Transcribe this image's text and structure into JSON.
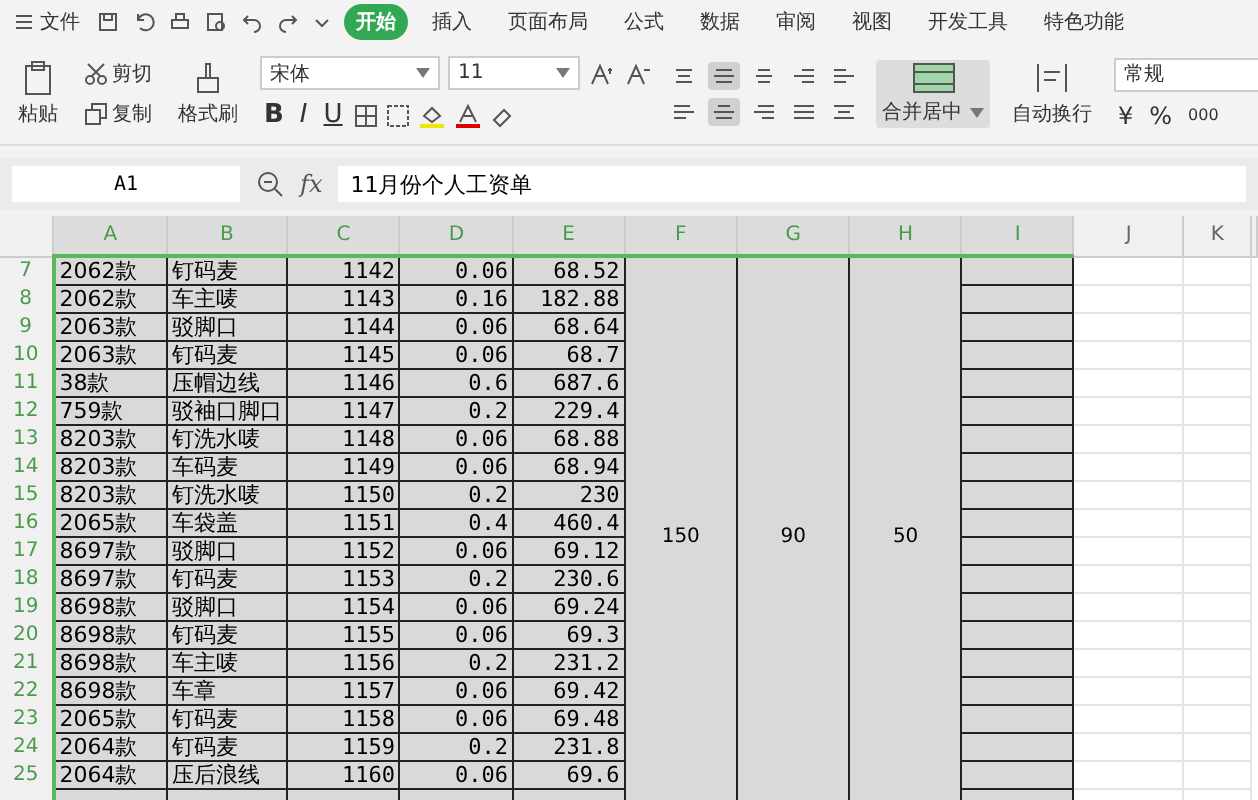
{
  "menu_bar": {
    "file_label": "文件",
    "tabs": [
      {
        "label": "开始",
        "selected": true
      },
      {
        "label": "插入",
        "selected": false
      },
      {
        "label": "页面布局",
        "selected": false
      },
      {
        "label": "公式",
        "selected": false
      },
      {
        "label": "数据",
        "selected": false
      },
      {
        "label": "审阅",
        "selected": false
      },
      {
        "label": "视图",
        "selected": false
      },
      {
        "label": "开发工具",
        "selected": false
      },
      {
        "label": "特色功能",
        "selected": false
      }
    ]
  },
  "ribbon": {
    "paste": "粘贴",
    "cut": "剪切",
    "copy": "复制",
    "format_painter": "格式刷",
    "font_name": "宋体",
    "font_size": "11",
    "bold": "B",
    "italic": "I",
    "underline": "U",
    "align_top": [
      {
        "kind": "top",
        "selected": false
      },
      {
        "kind": "middle",
        "selected": true
      },
      {
        "kind": "bottom",
        "selected": false
      },
      {
        "kind": "indent-out",
        "selected": false
      },
      {
        "kind": "indent-in",
        "selected": false
      }
    ],
    "align_bottom": [
      {
        "kind": "left",
        "selected": false
      },
      {
        "kind": "center",
        "selected": true
      },
      {
        "kind": "right",
        "selected": false
      },
      {
        "kind": "justify",
        "selected": false
      },
      {
        "kind": "distributed",
        "selected": false
      }
    ],
    "merge": "合并居中",
    "wrap": "自动换行",
    "number_format": "常规",
    "currency": "¥",
    "percent": "%",
    "thousands": "000"
  },
  "formula_bar": {
    "cell_ref": "A1",
    "fx": "fx",
    "content": "11月份个人工资单"
  },
  "sheet": {
    "columns": [
      {
        "label": "A",
        "selected": true
      },
      {
        "label": "B",
        "selected": true
      },
      {
        "label": "C",
        "selected": true
      },
      {
        "label": "D",
        "selected": true
      },
      {
        "label": "E",
        "selected": true
      },
      {
        "label": "F",
        "selected": true
      },
      {
        "label": "G",
        "selected": true
      },
      {
        "label": "H",
        "selected": true
      },
      {
        "label": "I",
        "selected": true
      },
      {
        "label": "J",
        "selected": false
      },
      {
        "label": "K",
        "selected": false
      }
    ],
    "merged": [
      "150",
      "90",
      "50"
    ],
    "rows": [
      {
        "number": "7",
        "cells": [
          "2062款",
          "钉码麦",
          "1142",
          "0.06",
          "68.52"
        ]
      },
      {
        "number": "8",
        "cells": [
          "2062款",
          "车主唛",
          "1143",
          "0.16",
          "182.88"
        ]
      },
      {
        "number": "9",
        "cells": [
          "2063款",
          "驳脚口",
          "1144",
          "0.06",
          "68.64"
        ]
      },
      {
        "number": "10",
        "cells": [
          "2063款",
          "钉码麦",
          "1145",
          "0.06",
          "68.7"
        ]
      },
      {
        "number": "11",
        "cells": [
          "38款",
          "压帽边线",
          "1146",
          "0.6",
          "687.6"
        ]
      },
      {
        "number": "12",
        "cells": [
          "759款",
          "驳袖口脚口",
          "1147",
          "0.2",
          "229.4"
        ]
      },
      {
        "number": "13",
        "cells": [
          "8203款",
          "钉洗水唛",
          "1148",
          "0.06",
          "68.88"
        ]
      },
      {
        "number": "14",
        "cells": [
          "8203款",
          "车码麦",
          "1149",
          "0.06",
          "68.94"
        ]
      },
      {
        "number": "15",
        "cells": [
          "8203款",
          "钉洗水唛",
          "1150",
          "0.2",
          "230"
        ]
      },
      {
        "number": "16",
        "cells": [
          "2065款",
          "车袋盖",
          "1151",
          "0.4",
          "460.4"
        ]
      },
      {
        "number": "17",
        "cells": [
          "8697款",
          "驳脚口",
          "1152",
          "0.06",
          "69.12"
        ]
      },
      {
        "number": "18",
        "cells": [
          "8697款",
          "钉码麦",
          "1153",
          "0.2",
          "230.6"
        ]
      },
      {
        "number": "19",
        "cells": [
          "8698款",
          "驳脚口",
          "1154",
          "0.06",
          "69.24"
        ]
      },
      {
        "number": "20",
        "cells": [
          "8698款",
          "钉码麦",
          "1155",
          "0.06",
          "69.3"
        ]
      },
      {
        "number": "21",
        "cells": [
          "8698款",
          "车主唛",
          "1156",
          "0.2",
          "231.2"
        ]
      },
      {
        "number": "22",
        "cells": [
          "8698款",
          "车章",
          "1157",
          "0.06",
          "69.42"
        ]
      },
      {
        "number": "23",
        "cells": [
          "2065款",
          "钉码麦",
          "1158",
          "0.06",
          "69.48"
        ]
      },
      {
        "number": "24",
        "cells": [
          "2064款",
          "钉码麦",
          "1159",
          "0.2",
          "231.8"
        ]
      },
      {
        "number": "25",
        "cells": [
          "2064款",
          "压后浪线",
          "1160",
          "0.06",
          "69.6"
        ]
      }
    ]
  }
}
